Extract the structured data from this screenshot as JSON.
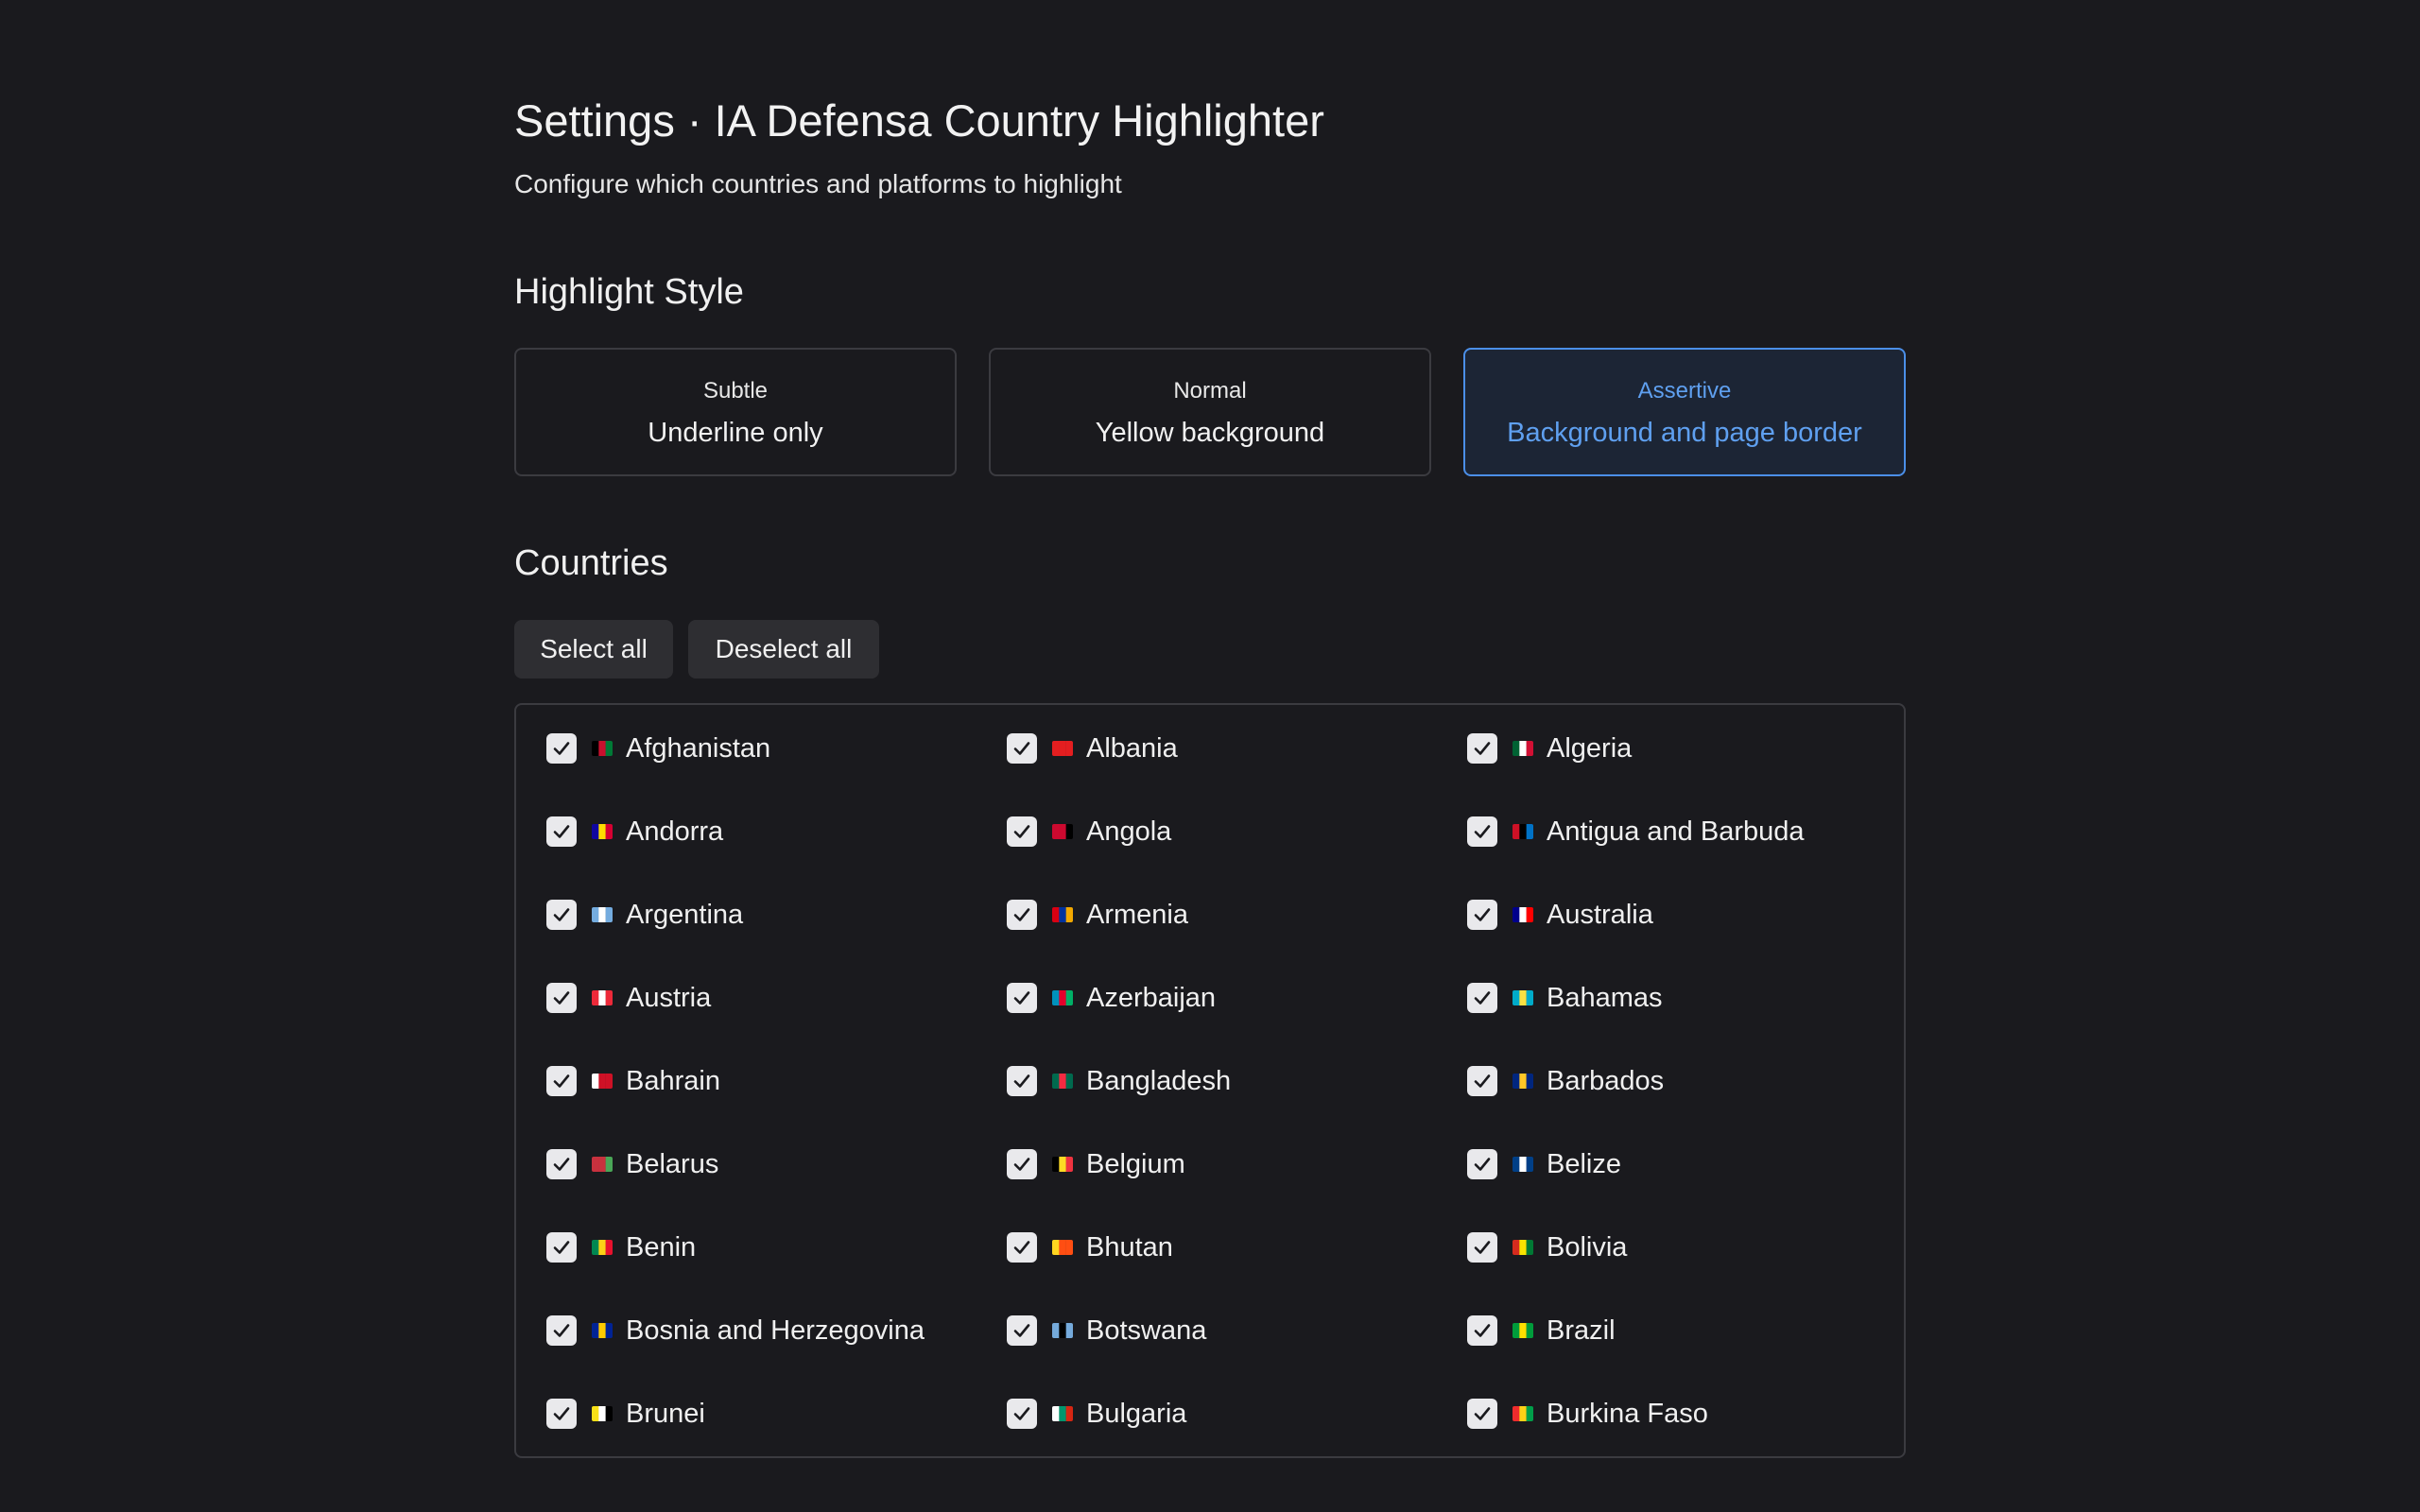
{
  "header": {
    "title": "Settings · IA Defensa Country Highlighter",
    "subtitle": "Configure which countries and platforms to highlight"
  },
  "highlight_style": {
    "heading": "Highlight Style",
    "selected": "assertive",
    "options": [
      {
        "id": "subtle",
        "name": "Subtle",
        "description": "Underline only"
      },
      {
        "id": "normal",
        "name": "Normal",
        "description": "Yellow background"
      },
      {
        "id": "assertive",
        "name": "Assertive",
        "description": "Background and page border"
      }
    ],
    "accent_color": "#5fa0f0"
  },
  "countries": {
    "heading": "Countries",
    "select_all_label": "Select all",
    "deselect_all_label": "Deselect all",
    "items": [
      {
        "name": "Afghanistan",
        "checked": true,
        "flag": [
          "#000000",
          "#c8102e",
          "#007a36"
        ]
      },
      {
        "name": "Albania",
        "checked": true,
        "flag": [
          "#e41e20",
          "#e41e20",
          "#e41e20"
        ]
      },
      {
        "name": "Algeria",
        "checked": true,
        "flag": [
          "#006233",
          "#ffffff",
          "#d21034"
        ]
      },
      {
        "name": "Andorra",
        "checked": true,
        "flag": [
          "#10069f",
          "#fedd00",
          "#d50032"
        ]
      },
      {
        "name": "Angola",
        "checked": true,
        "flag": [
          "#cc092f",
          "#cc092f",
          "#000000"
        ]
      },
      {
        "name": "Antigua and Barbuda",
        "checked": true,
        "flag": [
          "#ce1126",
          "#000000",
          "#0072c6"
        ]
      },
      {
        "name": "Argentina",
        "checked": true,
        "flag": [
          "#74acdf",
          "#ffffff",
          "#74acdf"
        ]
      },
      {
        "name": "Armenia",
        "checked": true,
        "flag": [
          "#d90012",
          "#0033a0",
          "#f2a800"
        ]
      },
      {
        "name": "Australia",
        "checked": true,
        "flag": [
          "#00008b",
          "#ffffff",
          "#ff0000"
        ]
      },
      {
        "name": "Austria",
        "checked": true,
        "flag": [
          "#ed2939",
          "#ffffff",
          "#ed2939"
        ]
      },
      {
        "name": "Azerbaijan",
        "checked": true,
        "flag": [
          "#0092bc",
          "#e4002b",
          "#00af66"
        ]
      },
      {
        "name": "Bahamas",
        "checked": true,
        "flag": [
          "#00abc9",
          "#fae042",
          "#00abc9"
        ]
      },
      {
        "name": "Bahrain",
        "checked": true,
        "flag": [
          "#ffffff",
          "#ce1126",
          "#ce1126"
        ]
      },
      {
        "name": "Bangladesh",
        "checked": true,
        "flag": [
          "#006a4e",
          "#f42a41",
          "#006a4e"
        ]
      },
      {
        "name": "Barbados",
        "checked": true,
        "flag": [
          "#00267f",
          "#ffc726",
          "#00267f"
        ]
      },
      {
        "name": "Belarus",
        "checked": true,
        "flag": [
          "#c8313e",
          "#c8313e",
          "#4aa657"
        ]
      },
      {
        "name": "Belgium",
        "checked": true,
        "flag": [
          "#000000",
          "#fdda24",
          "#ef3340"
        ]
      },
      {
        "name": "Belize",
        "checked": true,
        "flag": [
          "#003f87",
          "#ffffff",
          "#003f87"
        ]
      },
      {
        "name": "Benin",
        "checked": true,
        "flag": [
          "#008751",
          "#fcd116",
          "#e8112d"
        ]
      },
      {
        "name": "Bhutan",
        "checked": true,
        "flag": [
          "#ffd520",
          "#ff4e12",
          "#ff4e12"
        ]
      },
      {
        "name": "Bolivia",
        "checked": true,
        "flag": [
          "#d52b1e",
          "#f9e300",
          "#007934"
        ]
      },
      {
        "name": "Bosnia and Herzegovina",
        "checked": true,
        "flag": [
          "#002395",
          "#fecb00",
          "#002395"
        ]
      },
      {
        "name": "Botswana",
        "checked": true,
        "flag": [
          "#75aadb",
          "#000000",
          "#75aadb"
        ]
      },
      {
        "name": "Brazil",
        "checked": true,
        "flag": [
          "#009c3b",
          "#ffdf00",
          "#009c3b"
        ]
      },
      {
        "name": "Brunei",
        "checked": true,
        "flag": [
          "#f7e017",
          "#ffffff",
          "#000000"
        ]
      },
      {
        "name": "Bulgaria",
        "checked": true,
        "flag": [
          "#ffffff",
          "#00966e",
          "#d62612"
        ]
      },
      {
        "name": "Burkina Faso",
        "checked": true,
        "flag": [
          "#ef2b2d",
          "#fcd116",
          "#009e49"
        ]
      }
    ]
  }
}
